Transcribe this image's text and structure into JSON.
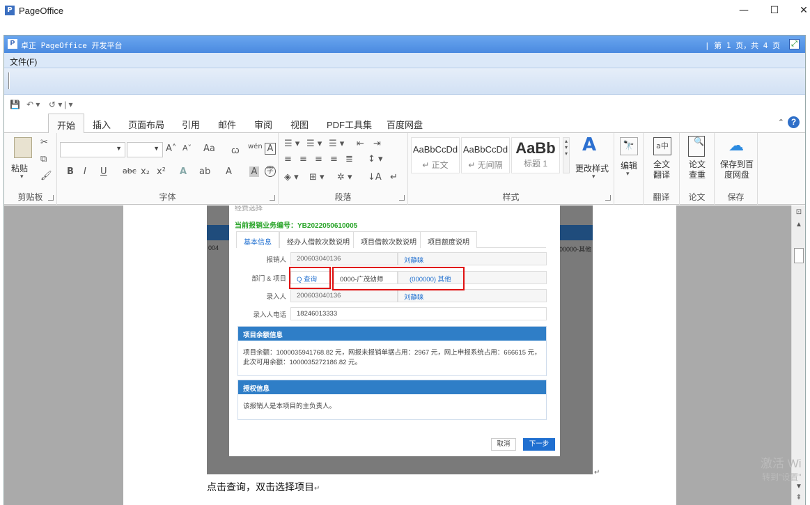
{
  "window": {
    "app_icon": "P",
    "title": "PageOffice",
    "minimize": "—",
    "maximize": "☐",
    "close": "✕"
  },
  "po_titlebar": {
    "icon": "P",
    "title": "卓正 PageOffice 开发平台",
    "page_info": "| 第 1 页，共 4 页"
  },
  "menubar": {
    "file": "文件(F)"
  },
  "qat": {
    "save": "💾",
    "undo": "↶ ▾",
    "redo": "↺ ▾",
    "customize": "| ▾"
  },
  "tabs": [
    {
      "label": "开始"
    },
    {
      "label": "插入"
    },
    {
      "label": "页面布局"
    },
    {
      "label": "引用"
    },
    {
      "label": "邮件"
    },
    {
      "label": "审阅"
    },
    {
      "label": "视图"
    },
    {
      "label": "PDF工具集"
    },
    {
      "label": "百度网盘"
    }
  ],
  "ribbon": {
    "clipboard": {
      "paste": "粘贴",
      "label": "剪贴板"
    },
    "font": {
      "label": "字体",
      "grow": "A˄",
      "shrink": "A˅",
      "case": "Aa",
      "clear": "A",
      "bold": "B",
      "italic": "I",
      "underline": "U",
      "strike": "abc",
      "sub": "x₂",
      "sup": "x²",
      "effect": "A",
      "highlight": "ab",
      "color": "A",
      "charbox": "A",
      "circle": "字"
    },
    "paragraph": {
      "label": "段落"
    },
    "styles": {
      "label": "样式",
      "items": [
        {
          "sample": "AaBbCcDd",
          "name": "↵ 正文"
        },
        {
          "sample": "AaBbCcDd",
          "name": "↵ 无间隔"
        },
        {
          "sample": "AaBb",
          "name": "标题 1"
        }
      ],
      "change_styles": "更改样式"
    },
    "editing": {
      "label": "编辑"
    },
    "translate": {
      "label": "全文\n翻译",
      "group": "翻译"
    },
    "paper": {
      "label": "论文\n查重",
      "group": "论文"
    },
    "save": {
      "label": "保存到百\n度网盘",
      "group": "保存"
    }
  },
  "doc": {
    "dialog_title": "经费选择",
    "biz_no": "当前报销业务编号：YB2022050610005",
    "tabs": [
      "基本信息",
      "经办人借款次数说明",
      "项目借款次数说明",
      "项目额度说明"
    ],
    "rows": [
      {
        "label": "报销人",
        "value": "200603040136",
        "value2": "刘静睐"
      },
      {
        "label": "部门 & 项目",
        "query": "Q 查询",
        "dept": "0000-广茂幼师",
        "project": "(000000) 其他"
      },
      {
        "label": "录入人",
        "value": "200603040136",
        "value2": "刘静睐"
      },
      {
        "label": "录入人电话",
        "value": "18246013333"
      }
    ],
    "balance_panel": {
      "title": "项目余额信息",
      "body": "项目余额：1000035941768.82 元，网报未报销单据占用：2967 元，网上申报系统占用：666615 元，此次可用余额：1000035272186.82 元。"
    },
    "auth_panel": {
      "title": "授权信息",
      "body": "该报销人是本项目的主负责人。"
    },
    "cancel": "取消",
    "next": "下一步",
    "side_left": "004",
    "side_right": "000000-其他",
    "caption": "点击查询，双击选择项目",
    "para_mark": "↵"
  },
  "watermark": {
    "line1": "激活 Wi",
    "line2": "转到\"设置\""
  },
  "colors": {
    "title_blue": "#4a8ae0",
    "panel_blue": "#2f7ec7",
    "highlight_red": "#e01010",
    "biz_green": "#2aa52a"
  }
}
